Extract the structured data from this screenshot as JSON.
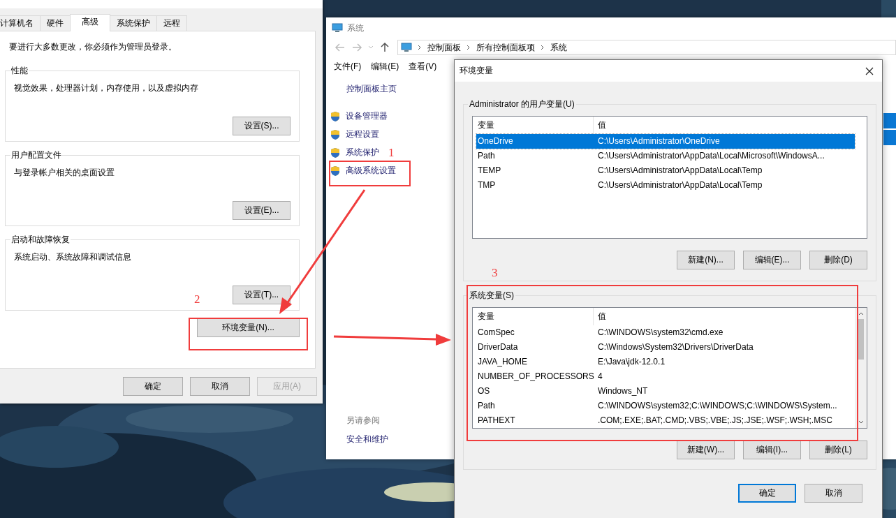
{
  "system_properties": {
    "tabs": [
      {
        "label": "计算机名",
        "selected": false
      },
      {
        "label": "硬件",
        "selected": false
      },
      {
        "label": "高级",
        "selected": true
      },
      {
        "label": "系统保护",
        "selected": false
      },
      {
        "label": "远程",
        "selected": false
      }
    ],
    "notice": "要进行大多数更改，你必须作为管理员登录。",
    "groups": [
      {
        "title": "性能",
        "description": "视觉效果，处理器计划，内存使用，以及虚拟内存",
        "button": "设置(S)..."
      },
      {
        "title": "用户配置文件",
        "description": "与登录帐户相关的桌面设置",
        "button": "设置(E)..."
      },
      {
        "title": "启动和故障恢复",
        "description": "系统启动、系统故障和调试信息",
        "button": "设置(T)..."
      }
    ],
    "env_button": "环境变量(N)...",
    "buttons": [
      {
        "label": "确定",
        "disabled": false
      },
      {
        "label": "取消",
        "disabled": false
      },
      {
        "label": "应用(A)",
        "disabled": true
      }
    ]
  },
  "system_window": {
    "title": "系统",
    "breadcrumb": [
      "控制面板",
      "所有控制面板项",
      "系统"
    ],
    "menu": [
      "文件(F)",
      "编辑(E)",
      "查看(V)"
    ],
    "home_link": "控制面板主页",
    "links": [
      "设备管理器",
      "远程设置",
      "系统保护",
      "高级系统设置"
    ],
    "see_also_title": "另请参阅",
    "see_also_links": [
      "安全和维护"
    ]
  },
  "env_dialog": {
    "title": "环境变量",
    "user_vars": {
      "title": "Administrator 的用户变量(U)",
      "columns": [
        "变量",
        "值"
      ],
      "rows": [
        {
          "name": "OneDrive",
          "value": "C:\\Users\\Administrator\\OneDrive",
          "selected": true
        },
        {
          "name": "Path",
          "value": "C:\\Users\\Administrator\\AppData\\Local\\Microsoft\\WindowsA...",
          "selected": false
        },
        {
          "name": "TEMP",
          "value": "C:\\Users\\Administrator\\AppData\\Local\\Temp",
          "selected": false
        },
        {
          "name": "TMP",
          "value": "C:\\Users\\Administrator\\AppData\\Local\\Temp",
          "selected": false
        }
      ],
      "buttons": [
        "新建(N)...",
        "编辑(E)...",
        "删除(D)"
      ]
    },
    "system_vars": {
      "title": "系统变量(S)",
      "columns": [
        "变量",
        "值"
      ],
      "rows": [
        {
          "name": "ComSpec",
          "value": "C:\\WINDOWS\\system32\\cmd.exe",
          "selected": false
        },
        {
          "name": "DriverData",
          "value": "C:\\Windows\\System32\\Drivers\\DriverData",
          "selected": false
        },
        {
          "name": "JAVA_HOME",
          "value": "E:\\Java\\jdk-12.0.1",
          "selected": false
        },
        {
          "name": "NUMBER_OF_PROCESSORS",
          "value": "4",
          "selected": false
        },
        {
          "name": "OS",
          "value": "Windows_NT",
          "selected": false
        },
        {
          "name": "Path",
          "value": "C:\\WINDOWS\\system32;C:\\WINDOWS;C:\\WINDOWS\\System...",
          "selected": false
        },
        {
          "name": "PATHEXT",
          "value": ".COM;.EXE;.BAT;.CMD;.VBS;.VBE;.JS;.JSE;.WSF;.WSH;.MSC",
          "selected": false
        }
      ],
      "buttons": [
        "新建(W)...",
        "编辑(I)...",
        "删除(L)"
      ]
    },
    "buttons": [
      {
        "label": "确定",
        "default": true
      },
      {
        "label": "取消",
        "default": false
      }
    ]
  },
  "annotations": {
    "numbers": [
      "1",
      "2",
      "3"
    ]
  }
}
